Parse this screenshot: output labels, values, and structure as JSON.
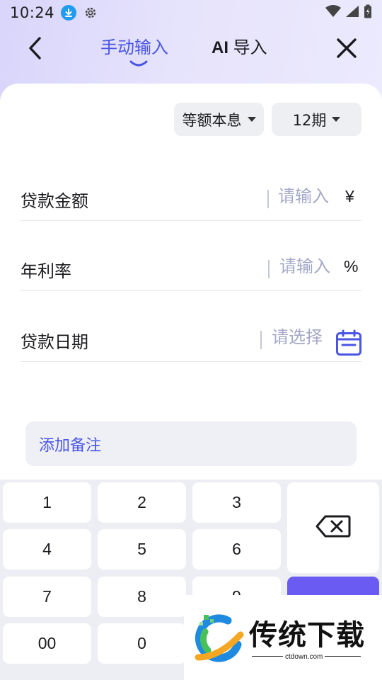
{
  "status_bar": {
    "time": "10:24"
  },
  "nav": {
    "tabs": [
      {
        "label": "手动输入",
        "active": true
      },
      {
        "label_latin": "AI",
        "label_cn": "导入",
        "active": false
      }
    ]
  },
  "options": {
    "repayment_method": "等额本息",
    "period": "12期"
  },
  "form": {
    "fields": [
      {
        "label": "贷款金额",
        "placeholder": "请输入",
        "unit": "¥"
      },
      {
        "label": "年利率",
        "placeholder": "请输入",
        "unit": "%"
      },
      {
        "label": "贷款日期",
        "placeholder": "请选择",
        "icon": "calendar-icon"
      }
    ],
    "note_label": "添加备注"
  },
  "keypad": {
    "keys": [
      "1",
      "2",
      "3",
      "4",
      "5",
      "6",
      "7",
      "8",
      "9",
      "00",
      "0"
    ],
    "backspace_icon": "backspace-icon"
  },
  "watermark": {
    "title": "传统下载",
    "url": "ctdown.com"
  },
  "colors": {
    "accent": "#4a55e6",
    "confirm": "#6a5cf2",
    "keypad_bg": "#eceef3",
    "status_icon": "#1f9cf0"
  }
}
